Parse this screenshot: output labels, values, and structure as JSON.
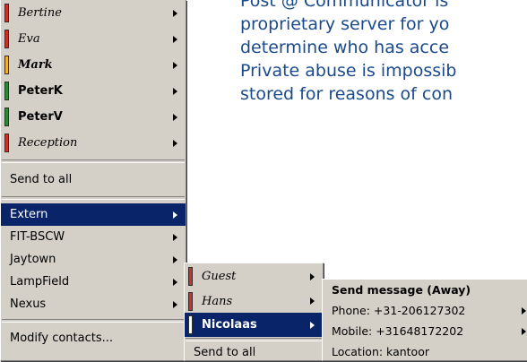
{
  "background_text": [
    "Post @ Communicator is",
    "proprietary server for yo",
    "determine who has acce",
    "Private abuse is impossib",
    "stored for reasons of con"
  ],
  "menu1": {
    "contacts": [
      {
        "label": "Bertine",
        "status_color": "#c8322a",
        "has_submenu": true
      },
      {
        "label": "Eva",
        "status_color": "#c8322a",
        "has_submenu": true
      },
      {
        "label": "Mark",
        "status_color": "#f0b030",
        "has_submenu": true
      },
      {
        "label": "PeterK",
        "status_color": "#2a8a3a",
        "has_submenu": true
      },
      {
        "label": "PeterV",
        "status_color": "#2a8a3a",
        "has_submenu": true
      },
      {
        "label": "Reception",
        "status_color": "#c8322a",
        "has_submenu": true
      }
    ],
    "send_to_all": "Send to all",
    "groups": [
      {
        "label": "Extern",
        "has_submenu": true,
        "selected": true
      },
      {
        "label": "FIT-BSCW",
        "has_submenu": true
      },
      {
        "label": "Jaytown",
        "has_submenu": true
      },
      {
        "label": "LampField",
        "has_submenu": true
      },
      {
        "label": "Nexus",
        "has_submenu": true
      }
    ],
    "modify_contacts": "Modify contacts..."
  },
  "menu2": {
    "contacts": [
      {
        "label": "Guest",
        "status_color": "#c8322a",
        "has_submenu": true
      },
      {
        "label": "Hans",
        "status_color": "#c8322a",
        "has_submenu": true
      },
      {
        "label": "Nicolaas",
        "status_color": "#ffffff",
        "has_submenu": true,
        "selected": true
      }
    ],
    "send_to_all": "Send to all"
  },
  "menu3": {
    "send_message": "Send message (Away)",
    "phone": "Phone: +31-206127302",
    "mobile": "Mobile: +31648172202",
    "location": "Location: kantoor"
  }
}
